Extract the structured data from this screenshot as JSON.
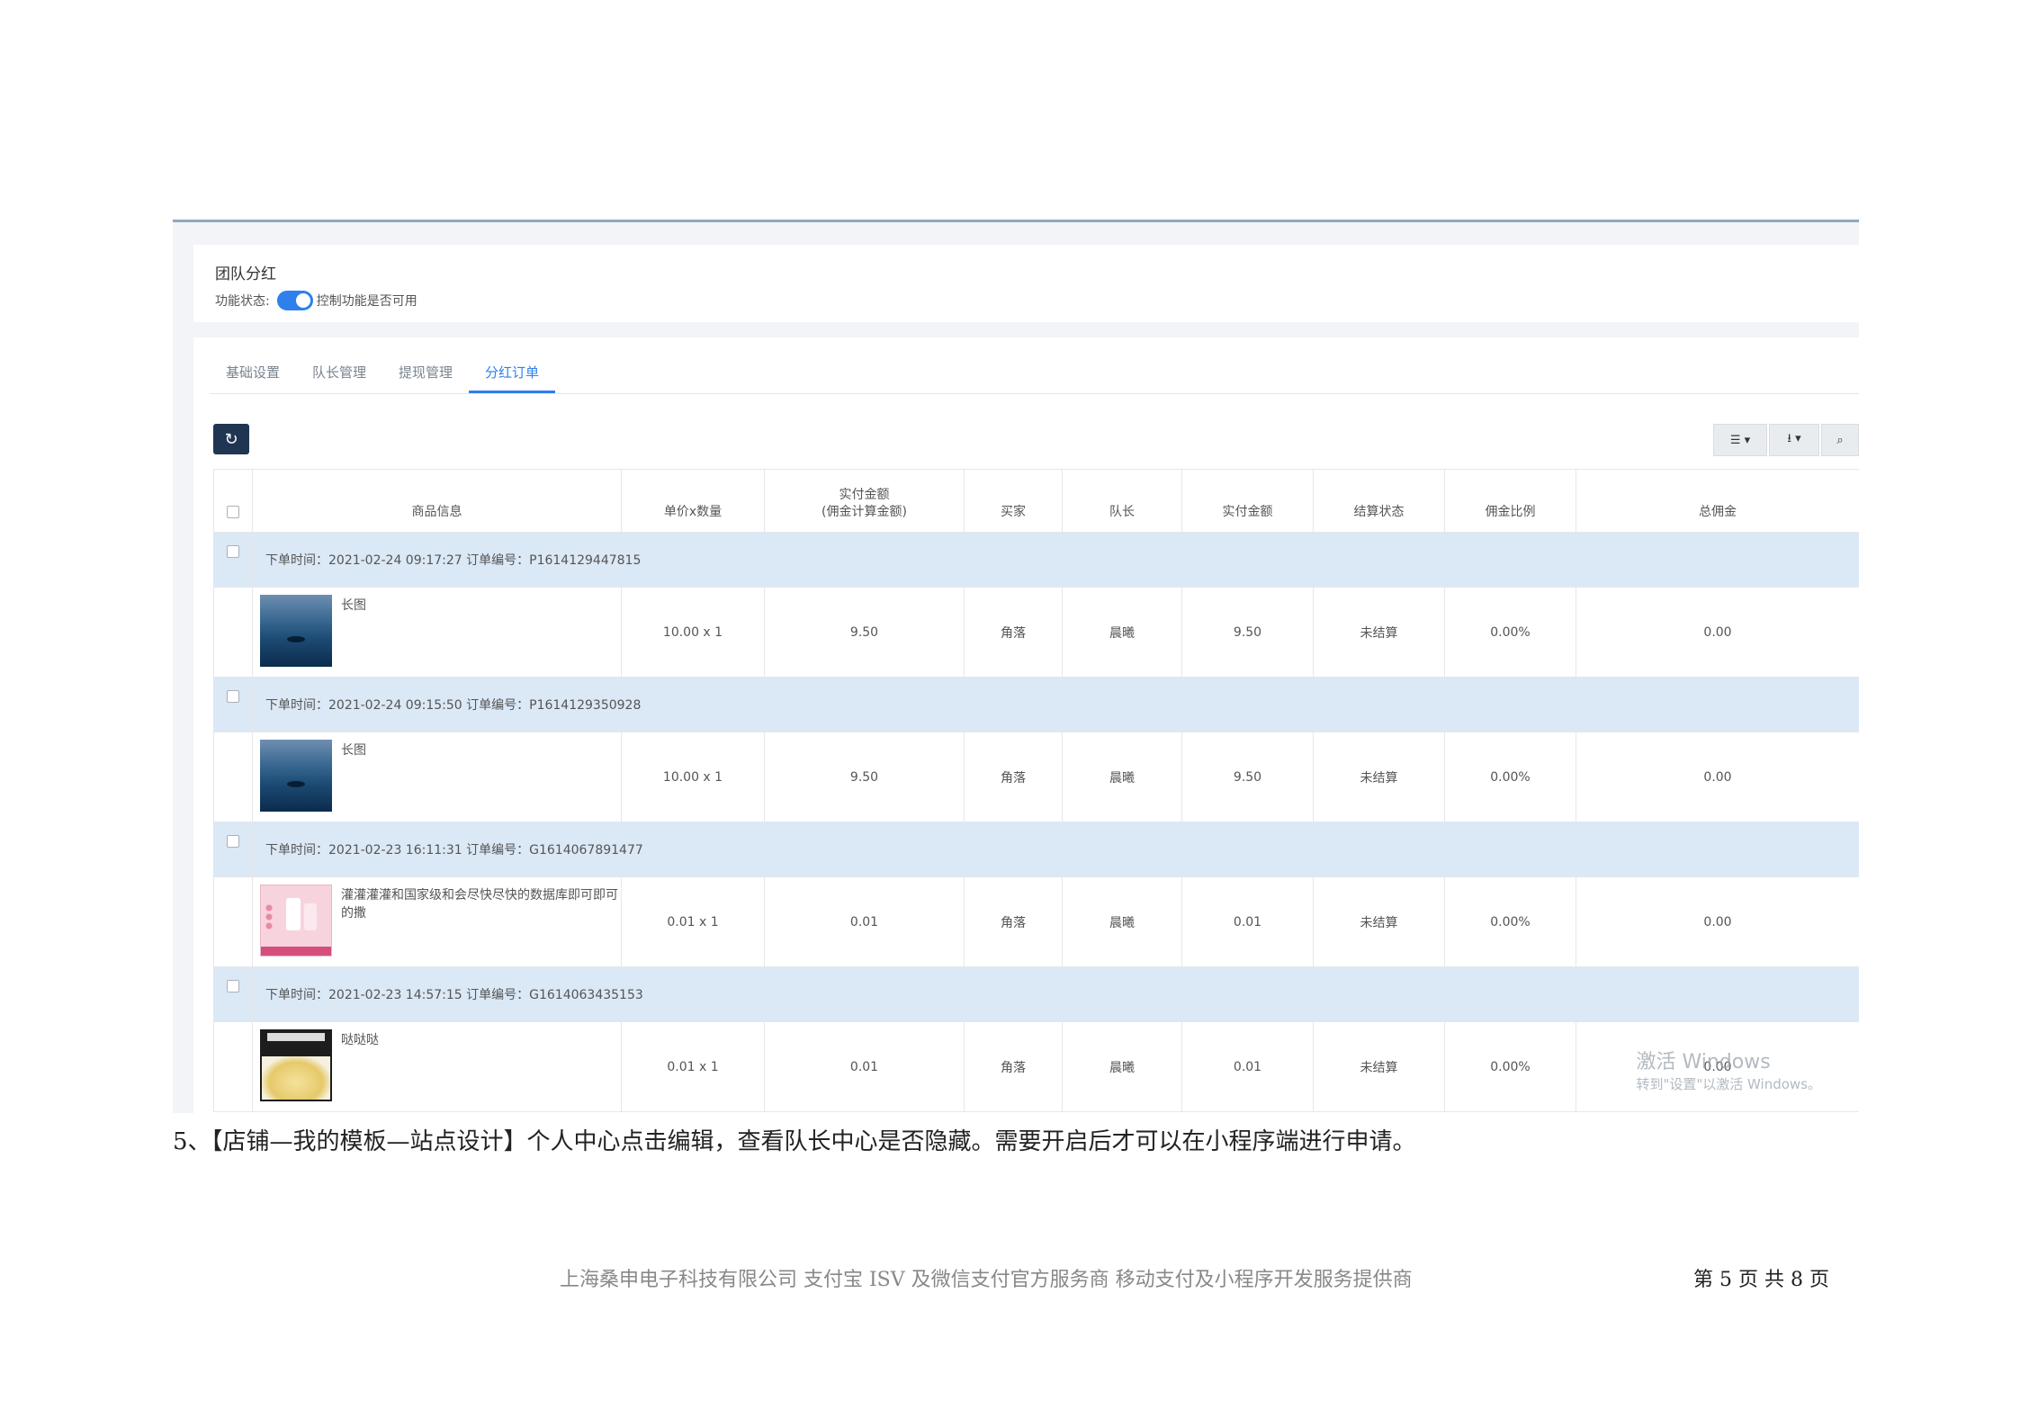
{
  "panel": {
    "title": "团队分红",
    "status_label": "功能状态:",
    "toggle_on": true,
    "status_desc": "控制功能是否可用"
  },
  "tabs": [
    {
      "label": "基础设置"
    },
    {
      "label": "队长管理"
    },
    {
      "label": "提现管理"
    },
    {
      "label": "分红订单",
      "active": true
    }
  ],
  "toolbar": {
    "refresh_icon": "refresh-icon",
    "columns_icon": "list-icon",
    "export_icon": "download-icon",
    "search_icon": "search-icon"
  },
  "table": {
    "headers": {
      "goods": "商品信息",
      "price_qty": "单价x数量",
      "paid_line1": "实付金额",
      "paid_line2": "(佣金计算金额)",
      "buyer": "买家",
      "leader": "队长",
      "paid": "实付金额",
      "settle": "结算状态",
      "rate": "佣金比例",
      "commission": "总佣金"
    },
    "orders": [
      {
        "info": "下单时间：2021-02-24 09:17:27  订单编号：P1614129447815",
        "goods_name": "长图",
        "price_qty": "10.00 x 1",
        "paid_calc": "9.50",
        "buyer": "角落",
        "leader": "晨曦",
        "paid": "9.50",
        "settle": "未结算",
        "rate": "0.00%",
        "commission": "0.00"
      },
      {
        "info": "下单时间：2021-02-24 09:15:50  订单编号：P1614129350928",
        "goods_name": "长图",
        "price_qty": "10.00 x 1",
        "paid_calc": "9.50",
        "buyer": "角落",
        "leader": "晨曦",
        "paid": "9.50",
        "settle": "未结算",
        "rate": "0.00%",
        "commission": "0.00"
      },
      {
        "info": "下单时间：2021-02-23 16:11:31  订单编号：G1614067891477",
        "goods_name": "灌灌灌灌和国家级和会尽快尽快的数据库即可即可的撒",
        "price_qty": "0.01 x 1",
        "paid_calc": "0.01",
        "buyer": "角落",
        "leader": "晨曦",
        "paid": "0.01",
        "settle": "未结算",
        "rate": "0.00%",
        "commission": "0.00"
      },
      {
        "info": "下单时间：2021-02-23 14:57:15  订单编号：G1614063435153",
        "goods_name": "哒哒哒",
        "price_qty": "0.01 x 1",
        "paid_calc": "0.01",
        "buyer": "角落",
        "leader": "晨曦",
        "paid": "0.01",
        "settle": "未结算",
        "rate": "0.00%",
        "commission": "0.00"
      }
    ]
  },
  "watermark": {
    "line1": "激活 Windows",
    "line2": "转到\"设置\"以激活 Windows。"
  },
  "doc": {
    "step_text": "5、【店铺—我的模板—站点设计】个人中心点击编辑，查看队长中心是否隐藏。需要开启后才可以在小程序端进行申请。",
    "footer_left": "上海桑申电子科技有限公司    支付宝 ISV 及微信支付官方服务商    移动支付及小程序开发服务提供商",
    "footer_right": "第 5 页 共 8 页"
  },
  "colors": {
    "accent": "#2f80ed",
    "order_row_bg": "#dbe8f5",
    "refresh_btn": "#1f3552"
  }
}
